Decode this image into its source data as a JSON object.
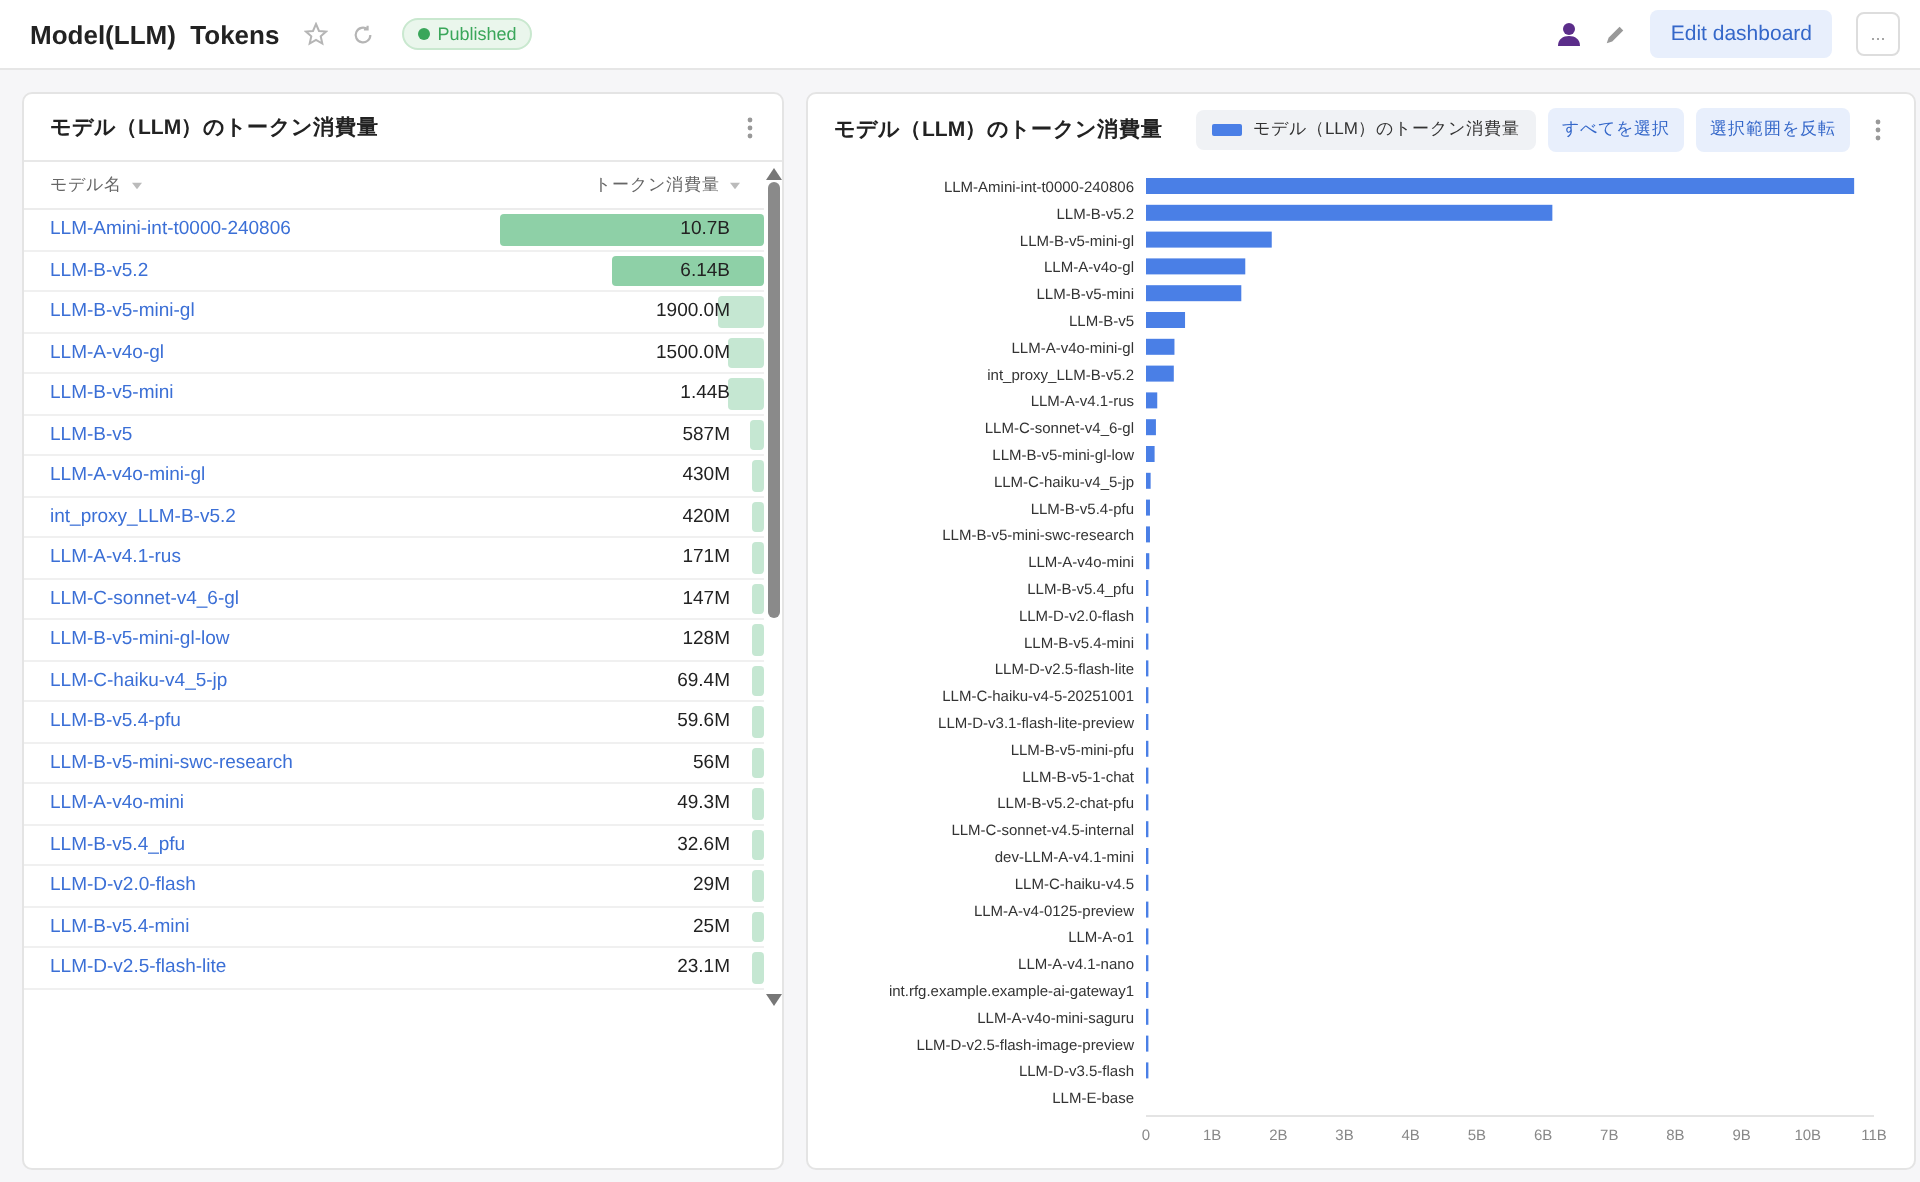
{
  "header": {
    "title": "Model(LLM)  Tokens",
    "status": "Published",
    "edit_button": "Edit dashboard",
    "more_button": "..."
  },
  "table_panel": {
    "title": "モデル（LLM）のトークン消費量",
    "columns": [
      "モデル名",
      "トークン消費量"
    ],
    "rows": [
      {
        "model": "LLM-Amini-int-t0000-240806",
        "tokens": "10.7B"
      },
      {
        "model": "LLM-B-v5.2",
        "tokens": "6.14B"
      },
      {
        "model": "LLM-B-v5-mini-gl",
        "tokens": "1900.0M"
      },
      {
        "model": "LLM-A-v4o-gl",
        "tokens": "1500.0M"
      },
      {
        "model": "LLM-B-v5-mini",
        "tokens": "1.44B"
      },
      {
        "model": "LLM-B-v5",
        "tokens": "587M"
      },
      {
        "model": "LLM-A-v4o-mini-gl",
        "tokens": "430M"
      },
      {
        "model": "int_proxy_LLM-B-v5.2",
        "tokens": "420M"
      },
      {
        "model": "LLM-A-v4.1-rus",
        "tokens": "171M"
      },
      {
        "model": "LLM-C-sonnet-v4_6-gl",
        "tokens": "147M"
      },
      {
        "model": "LLM-B-v5-mini-gl-low",
        "tokens": "128M"
      },
      {
        "model": "LLM-C-haiku-v4_5-jp",
        "tokens": "69.4M"
      },
      {
        "model": "LLM-B-v5.4-pfu",
        "tokens": "59.6M"
      },
      {
        "model": "LLM-B-v5-mini-swc-research",
        "tokens": "56M"
      },
      {
        "model": "LLM-A-v4o-mini",
        "tokens": "49.3M"
      },
      {
        "model": "LLM-B-v5.4_pfu",
        "tokens": "32.6M"
      },
      {
        "model": "LLM-D-v2.0-flash",
        "tokens": "29M"
      },
      {
        "model": "LLM-B-v5.4-mini",
        "tokens": "25M"
      },
      {
        "model": "LLM-D-v2.5-flash-lite",
        "tokens": "23.1M"
      }
    ]
  },
  "chart_panel": {
    "title": "モデル（LLM）のトークン消費量",
    "actions": [
      "すべてを選択",
      "選択範囲を反転"
    ],
    "chart_data": {
      "type": "bar",
      "orientation": "horizontal",
      "categories": [
        "LLM-Amini-int-t0000-240806",
        "LLM-B-v5.2",
        "LLM-B-v5-mini-gl",
        "LLM-A-v4o-gl",
        "LLM-B-v5-mini",
        "LLM-B-v5",
        "LLM-A-v4o-mini-gl",
        "int_proxy_LLM-B-v5.2",
        "LLM-A-v4.1-rus",
        "LLM-C-sonnet-v4_6-gl",
        "LLM-B-v5-mini-gl-low",
        "LLM-C-haiku-v4_5-jp",
        "LLM-B-v5.4-pfu",
        "LLM-B-v5-mini-swc-research",
        "LLM-A-v4o-mini",
        "LLM-B-v5.4_pfu",
        "LLM-D-v2.0-flash",
        "LLM-B-v5.4-mini",
        "LLM-D-v2.5-flash-lite",
        "LLM-C-haiku-v4-5-20251001",
        "LLM-D-v3.1-flash-lite-preview",
        "LLM-B-v5-mini-pfu",
        "LLM-B-v5-1-chat",
        "LLM-B-v5.2-chat-pfu",
        "LLM-C-sonnet-v4.5-internal",
        "dev-LLM-A-v4.1-mini",
        "LLM-C-haiku-v4.5",
        "LLM-A-v4-0125-preview",
        "LLM-A-o1",
        "LLM-A-v4.1-nano",
        "int.rfg.example.example-ai-gateway1",
        "LLM-A-v4o-mini-saguru",
        "LLM-D-v2.5-flash-image-preview",
        "LLM-D-v3.5-flash",
        "LLM-E-base"
      ],
      "series": [
        {
          "name": "モデル（LLM）のトークン消費量",
          "color": "#4a7fe6",
          "values": [
            10.7,
            6.14,
            1.9,
            1.5,
            1.44,
            0.59,
            0.43,
            0.42,
            0.17,
            0.15,
            0.13,
            0.07,
            0.06,
            0.06,
            0.05,
            0.03,
            0.03,
            0.03,
            0.02,
            0.02,
            0.02,
            0.02,
            0.02,
            0.01,
            0.01,
            0.01,
            0.01,
            0.01,
            0.01,
            0.01,
            0.01,
            0.01,
            0.01,
            0.01,
            0
          ]
        }
      ],
      "xlim": [
        0,
        11
      ],
      "xticks": [
        {
          "value": 0,
          "label": "0"
        },
        {
          "value": 1,
          "label": "1B"
        },
        {
          "value": 2,
          "label": "2B"
        },
        {
          "value": 3,
          "label": "3B"
        },
        {
          "value": 4,
          "label": "4B"
        },
        {
          "value": 5,
          "label": "5B"
        },
        {
          "value": 6,
          "label": "6B"
        },
        {
          "value": 7,
          "label": "7B"
        },
        {
          "value": 8,
          "label": "8B"
        },
        {
          "value": 9,
          "label": "9B"
        },
        {
          "value": 10,
          "label": "10B"
        },
        {
          "value": 11,
          "label": "11B"
        }
      ]
    }
  }
}
